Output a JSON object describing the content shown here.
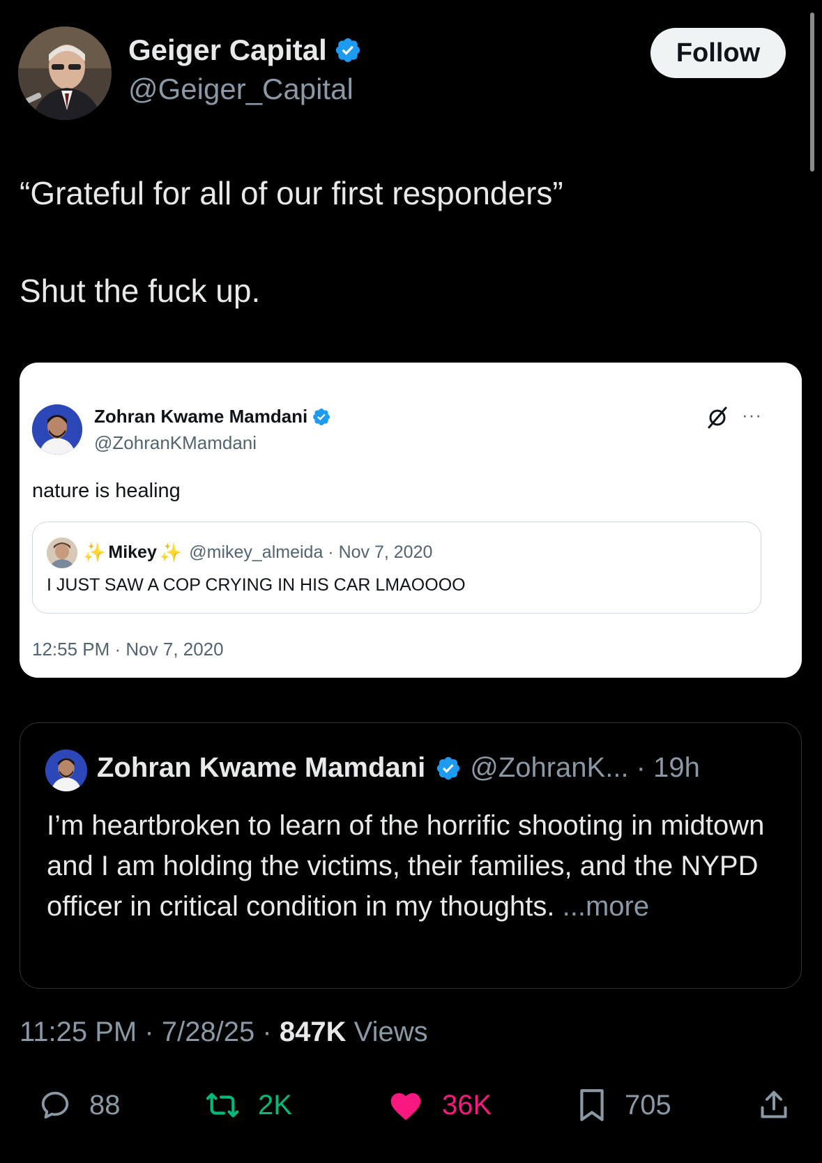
{
  "tweet": {
    "author": {
      "name": "Geiger Capital",
      "handle": "@Geiger_Capital",
      "verified": true
    },
    "follow_label": "Follow",
    "text_line1": "“Grateful for all of our first responders”",
    "text_line2": "Shut the fuck up.",
    "time": "11:25 PM",
    "date": "7/28/25",
    "views_count": "847K",
    "views_label": "Views",
    "sep": "·"
  },
  "screenshot_card": {
    "author_name": "Zohran Kwame Mamdani",
    "author_handle": "@ZohranKMamdani",
    "more_icon": "···",
    "text": "nature is healing",
    "quoted": {
      "sparkle_left": "✨",
      "name": "Mikey",
      "sparkle_right": "✨",
      "handle_and_date": "@mikey_almeida · Nov 7, 2020",
      "text": "I JUST SAW A COP CRYING IN HIS CAR LMAOOOO"
    },
    "timestamp": "12:55 PM · Nov 7, 2020"
  },
  "quoted_tweet": {
    "author_name": "Zohran Kwame Mamdani",
    "meta": "@ZohranK... · 19h",
    "text": "I’m heartbroken to learn of the horrific shooting in midtown and I am holding the victims, their families, and the NYPD officer in critical condition in my thoughts.",
    "more": " ...more"
  },
  "actions": {
    "replies": "88",
    "reposts": "2K",
    "likes": "36K",
    "bookmarks": "705"
  },
  "colors": {
    "background": "#000000",
    "verified_blue": "#1d9bf0",
    "repost_green": "#00ba7c",
    "like_pink": "#f91880",
    "muted_text": "#8b98a5"
  },
  "icons": [
    "verified-badge-icon",
    "grok-icon",
    "more-icon",
    "reply-icon",
    "repost-icon",
    "like-icon",
    "bookmark-icon",
    "share-icon"
  ]
}
